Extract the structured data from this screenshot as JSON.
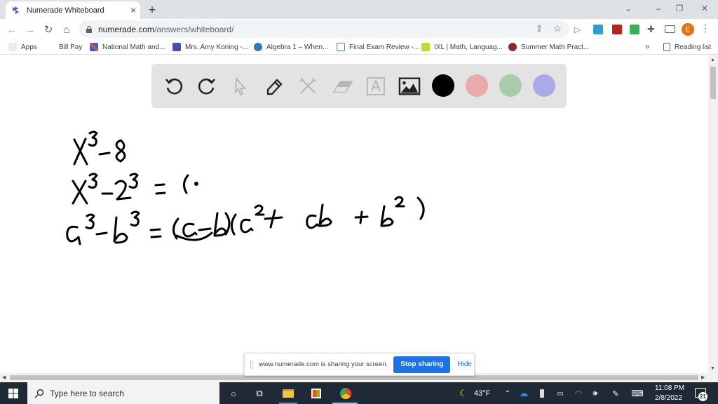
{
  "browser": {
    "tab": {
      "title": "Numerade Whiteboard",
      "close": "×"
    },
    "new_tab": "+",
    "window_controls": {
      "tab_search": "⌄",
      "minimize": "–",
      "restore": "❐",
      "close": "✕"
    },
    "nav": {
      "back": "←",
      "forward": "→",
      "reload": "↻",
      "home": "⌂"
    },
    "address": {
      "host": "numerade.com",
      "path": "/answers/whiteboard/"
    },
    "profile_initial": "E",
    "menu": "⋮",
    "bookmarks": [
      {
        "label": "Apps",
        "icon": "apps-grid-icon"
      },
      {
        "label": "Bill Pay",
        "icon": ""
      },
      {
        "label": "National Math and...",
        "icon": "national-math-icon"
      },
      {
        "label": "Mrs. Amy Koning -...",
        "icon": "calendar-icon"
      },
      {
        "label": "Algebra 1 – When...",
        "icon": "wordpress-icon"
      },
      {
        "label": "Final Exam Review -...",
        "icon": "forms-icon"
      },
      {
        "label": "IXL | Math, Languag...",
        "icon": "ixl-icon"
      },
      {
        "label": "Summer Math Pract...",
        "icon": "summer-math-icon"
      }
    ],
    "bookmarks_overflow": "»",
    "reading_list": "Reading list"
  },
  "whiteboard": {
    "tools": [
      {
        "name": "undo",
        "enabled": true
      },
      {
        "name": "redo",
        "enabled": true
      },
      {
        "name": "select",
        "enabled": false
      },
      {
        "name": "pen",
        "enabled": true
      },
      {
        "name": "tools",
        "enabled": false
      },
      {
        "name": "eraser",
        "enabled": false
      },
      {
        "name": "text",
        "enabled": false
      },
      {
        "name": "image",
        "enabled": true
      }
    ],
    "colors": [
      {
        "name": "black",
        "hex": "#000000",
        "selected": true
      },
      {
        "name": "red",
        "hex": "#e8aaaa"
      },
      {
        "name": "green",
        "hex": "#aacbaa"
      },
      {
        "name": "blue",
        "hex": "#abaae8"
      }
    ],
    "handwriting": [
      "x³ − 8",
      "x³ − 2³ = (·",
      "a³ − b³ = (a − b)(a² + ab + b²)"
    ]
  },
  "sharing_bar": {
    "message": "www.numerade.com is sharing your screen.",
    "stop_label": "Stop sharing",
    "hide_label": "Hide"
  },
  "taskbar": {
    "search_placeholder": "Type here to search",
    "weather": "43°F",
    "time": "11:08 PM",
    "date": "2/8/2022",
    "notifications": "21"
  }
}
